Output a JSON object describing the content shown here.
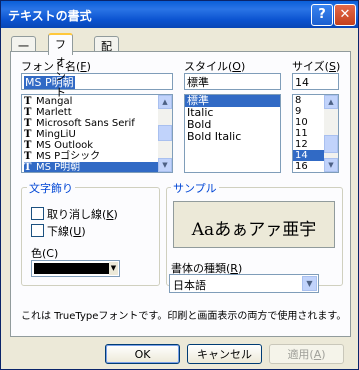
{
  "window": {
    "title": "テキストの書式",
    "help": "?",
    "close": "✕"
  },
  "tabs": [
    {
      "label": "一般"
    },
    {
      "label": "フォント"
    },
    {
      "label": "配置"
    }
  ],
  "font": {
    "label": "フォント名(F)",
    "label_text": "フォント名(",
    "label_key": "F",
    "label_end": ")",
    "value": "MS P明朝",
    "items": [
      "Mangal",
      "Marlett",
      "Microsoft Sans Serif",
      "MingLiU",
      "MS Outlook",
      "MS Pゴシック",
      "MS P明朝"
    ],
    "tt_icon": "T"
  },
  "style": {
    "label_text": "スタイル(",
    "label_key": "O",
    "label_end": ")",
    "value": "標準",
    "items": [
      "標準",
      "Italic",
      "Bold",
      "Bold Italic"
    ]
  },
  "size": {
    "label_text": "サイズ(",
    "label_key": "S",
    "label_end": ")",
    "value": "14",
    "items": [
      "8",
      "9",
      "10",
      "11",
      "12",
      "14",
      "16"
    ]
  },
  "effects": {
    "title": "文字飾り",
    "strike_text": "取り消し線(",
    "strike_key": "K",
    "underline_text": "下線(",
    "underline_key": "U",
    "end": ")",
    "color_label": "色(C)",
    "color_value": "#000000"
  },
  "sample": {
    "title": "サンプル",
    "text": "Aaあぁアァ亜宇"
  },
  "script": {
    "label_text": "書体の種類(",
    "label_key": "R",
    "label_end": ")",
    "value": "日本語"
  },
  "info": "これは TrueTypeフォントです。印刷と画面表示の両方で使用されます。",
  "buttons": {
    "ok": "OK",
    "cancel": "キャンセル",
    "apply_text": "適用(",
    "apply_key": "A",
    "apply_end": ")"
  }
}
